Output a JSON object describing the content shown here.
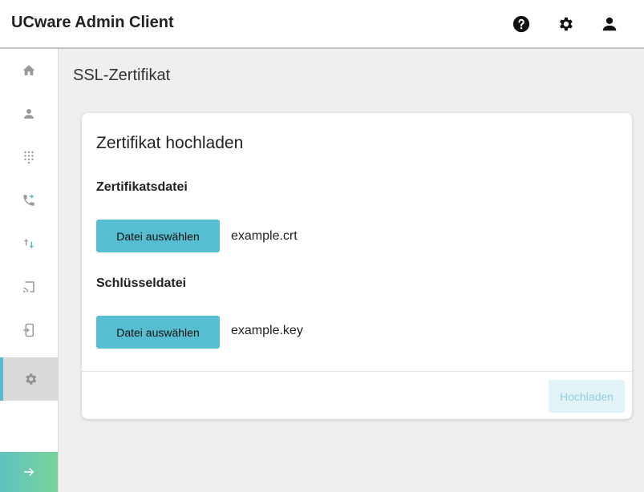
{
  "header": {
    "title": "UCware Admin Client",
    "icons": [
      "help-icon",
      "gear-icon",
      "user-icon"
    ]
  },
  "sidebar": {
    "items": [
      {
        "icon": "home-icon"
      },
      {
        "icon": "user-icon"
      },
      {
        "icon": "dialpad-icon"
      },
      {
        "icon": "call-forward-icon"
      },
      {
        "icon": "swap-arrows-icon"
      },
      {
        "icon": "cast-icon"
      },
      {
        "icon": "device-login-icon"
      },
      {
        "icon": "gear-icon",
        "active": true
      }
    ],
    "expand_icon": "arrow-right-icon"
  },
  "page": {
    "title": "SSL-Zertifikat"
  },
  "card": {
    "title": "Zertifikat hochladen",
    "certificate": {
      "label": "Zertifikatsdatei",
      "button_label": "Datei auswählen",
      "file_name": "example.crt"
    },
    "key": {
      "label": "Schlüsseldatei",
      "button_label": "Datei auswählen",
      "file_name": "example.key"
    },
    "upload_label": "Hochladen"
  },
  "colors": {
    "accent": "#57bdd0",
    "upload_disabled_bg": "#e2f3f7",
    "sidebar_icon": "#9a9a9a"
  }
}
